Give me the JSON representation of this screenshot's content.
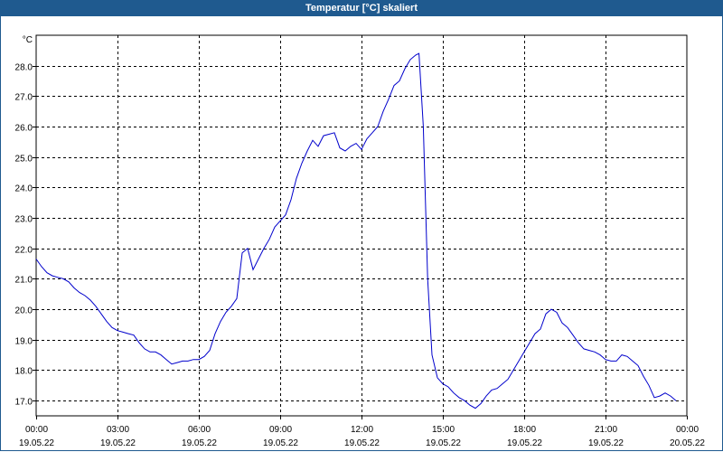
{
  "window": {
    "title": "Temperatur [°C] skaliert"
  },
  "chart_data": {
    "type": "line",
    "title": "Temperatur [°C] skaliert",
    "ylabel": "°C",
    "xlabel": "",
    "ylim": [
      16.5,
      29.0
    ],
    "yticks": [
      17.0,
      18.0,
      19.0,
      20.0,
      21.0,
      22.0,
      23.0,
      24.0,
      25.0,
      26.0,
      27.0,
      28.0
    ],
    "xlim": [
      "2022-05-19 00:00",
      "2022-05-20 00:00"
    ],
    "xticks": [
      {
        "time": "00:00",
        "date": "19.05.22",
        "hour": 0
      },
      {
        "time": "03:00",
        "date": "19.05.22",
        "hour": 3
      },
      {
        "time": "06:00",
        "date": "19.05.22",
        "hour": 6
      },
      {
        "time": "09:00",
        "date": "19.05.22",
        "hour": 9
      },
      {
        "time": "12:00",
        "date": "19.05.22",
        "hour": 12
      },
      {
        "time": "15:00",
        "date": "19.05.22",
        "hour": 15
      },
      {
        "time": "18:00",
        "date": "19.05.22",
        "hour": 18
      },
      {
        "time": "21:00",
        "date": "19.05.22",
        "hour": 21
      },
      {
        "time": "00:00",
        "date": "20.05.22",
        "hour": 24
      }
    ],
    "grid": true,
    "series": [
      {
        "color": "#0000cc",
        "points": [
          [
            0.0,
            21.65
          ],
          [
            0.25,
            21.4
          ],
          [
            0.5,
            21.2
          ],
          [
            0.75,
            21.1
          ],
          [
            1.0,
            21.05
          ],
          [
            1.25,
            21.0
          ],
          [
            1.5,
            20.9
          ],
          [
            1.75,
            20.7
          ],
          [
            2.0,
            20.55
          ],
          [
            2.25,
            20.45
          ],
          [
            2.5,
            20.3
          ],
          [
            2.75,
            20.1
          ],
          [
            3.0,
            19.85
          ],
          [
            3.25,
            19.6
          ],
          [
            3.5,
            19.4
          ],
          [
            3.75,
            19.3
          ],
          [
            4.0,
            19.25
          ],
          [
            4.25,
            19.2
          ],
          [
            4.5,
            19.15
          ],
          [
            4.75,
            18.9
          ],
          [
            5.0,
            18.7
          ],
          [
            5.25,
            18.6
          ],
          [
            5.5,
            18.6
          ],
          [
            5.75,
            18.5
          ],
          [
            6.0,
            18.35
          ],
          [
            6.25,
            18.2
          ],
          [
            6.5,
            18.25
          ],
          [
            6.75,
            18.3
          ],
          [
            7.0,
            18.3
          ],
          [
            7.25,
            18.35
          ],
          [
            7.5,
            18.35
          ],
          [
            7.75,
            18.45
          ],
          [
            8.0,
            18.65
          ],
          [
            8.25,
            19.2
          ],
          [
            8.5,
            19.6
          ],
          [
            8.75,
            19.9
          ],
          [
            9.0,
            20.1
          ],
          [
            9.25,
            20.35
          ],
          [
            9.5,
            21.85
          ],
          [
            9.75,
            22.0
          ],
          [
            10.0,
            21.3
          ],
          [
            10.25,
            21.65
          ],
          [
            10.5,
            22.0
          ],
          [
            10.75,
            22.3
          ],
          [
            11.0,
            22.7
          ],
          [
            11.25,
            22.9
          ],
          [
            11.5,
            23.1
          ],
          [
            11.75,
            23.6
          ],
          [
            12.0,
            24.3
          ],
          [
            12.25,
            24.8
          ],
          [
            12.5,
            25.2
          ],
          [
            12.75,
            25.55
          ],
          [
            13.0,
            25.35
          ],
          [
            13.25,
            25.7
          ],
          [
            13.5,
            25.75
          ],
          [
            13.75,
            25.8
          ],
          [
            14.0,
            25.3
          ],
          [
            14.25,
            25.2
          ],
          [
            14.5,
            25.35
          ],
          [
            14.75,
            25.45
          ],
          [
            15.0,
            25.25
          ],
          [
            15.25,
            25.6
          ],
          [
            15.5,
            25.8
          ],
          [
            15.75,
            26.0
          ],
          [
            16.0,
            26.5
          ],
          [
            16.25,
            26.9
          ],
          [
            16.5,
            27.35
          ],
          [
            16.75,
            27.5
          ],
          [
            17.0,
            27.9
          ],
          [
            17.25,
            28.2
          ],
          [
            17.5,
            28.35
          ],
          [
            17.65,
            28.4
          ],
          [
            17.85,
            26.0
          ],
          [
            18.05,
            21.0
          ],
          [
            18.25,
            18.5
          ],
          [
            18.5,
            17.75
          ],
          [
            18.75,
            17.55
          ],
          [
            19.0,
            17.45
          ],
          [
            19.25,
            17.25
          ],
          [
            19.5,
            17.1
          ],
          [
            19.75,
            17.0
          ],
          [
            20.0,
            16.85
          ],
          [
            20.25,
            16.75
          ],
          [
            20.5,
            16.9
          ],
          [
            20.75,
            17.15
          ],
          [
            21.0,
            17.35
          ],
          [
            21.25,
            17.4
          ],
          [
            21.5,
            17.55
          ],
          [
            21.75,
            17.7
          ],
          [
            22.0,
            18.0
          ],
          [
            22.25,
            18.3
          ],
          [
            22.5,
            18.6
          ],
          [
            22.75,
            18.9
          ],
          [
            23.0,
            19.2
          ],
          [
            23.25,
            19.35
          ],
          [
            23.5,
            19.85
          ],
          [
            23.75,
            20.0
          ],
          [
            24.0,
            19.9
          ],
          [
            24.25,
            19.55
          ],
          [
            24.5,
            19.4
          ],
          [
            24.75,
            19.15
          ],
          [
            25.0,
            18.9
          ],
          [
            25.25,
            18.7
          ],
          [
            25.5,
            18.65
          ],
          [
            25.75,
            18.6
          ],
          [
            26.0,
            18.5
          ],
          [
            26.25,
            18.35
          ],
          [
            26.5,
            18.3
          ],
          [
            26.75,
            18.3
          ],
          [
            27.0,
            18.5
          ],
          [
            27.25,
            18.45
          ],
          [
            27.5,
            18.3
          ],
          [
            27.75,
            18.15
          ],
          [
            28.0,
            17.8
          ],
          [
            28.25,
            17.5
          ],
          [
            28.5,
            17.1
          ],
          [
            28.75,
            17.15
          ],
          [
            29.0,
            17.25
          ],
          [
            29.25,
            17.15
          ],
          [
            29.5,
            17.0
          ]
        ]
      }
    ]
  }
}
